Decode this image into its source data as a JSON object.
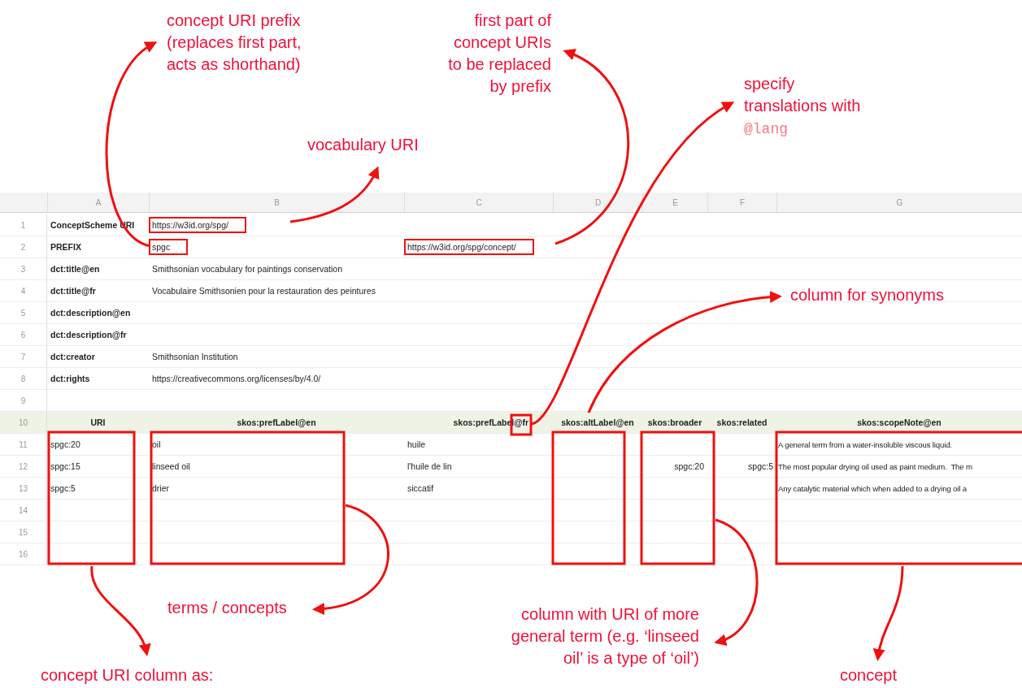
{
  "annotations": [
    {
      "kind": "note",
      "lines": [
        "concept URI prefix",
        "(replaces first part,",
        "acts as shorthand)"
      ]
    },
    {
      "kind": "note",
      "lines": [
        "first part of",
        "concept URIs",
        "to be replaced",
        "by prefix"
      ]
    },
    {
      "kind": "note",
      "lines": [
        "vocabulary URI"
      ]
    },
    {
      "kind": "note",
      "lines": [
        "specify",
        "translations with"
      ]
    },
    {
      "kind": "code",
      "lines": [
        "@lang"
      ]
    },
    {
      "kind": "note",
      "lines": [
        "column for synonyms"
      ]
    },
    {
      "kind": "note",
      "lines": [
        "terms / concepts"
      ]
    },
    {
      "kind": "note",
      "lines": [
        "column with URI of more",
        "general term (e.g. ‘linseed",
        "oil’ is a type of ‘oil’)"
      ]
    },
    {
      "kind": "note",
      "lines": [
        "concept URI column as:"
      ]
    },
    {
      "kind": "note",
      "lines": [
        "concept"
      ]
    }
  ],
  "sheet": {
    "columns": [
      "A",
      "B",
      "C",
      "D",
      "E",
      "F",
      "G"
    ],
    "rows": [
      {
        "number": "1",
        "kind": "meta",
        "cells": [
          "ConceptScheme URI",
          "https://w3id.org/spg/"
        ],
        "framed": [
          false,
          true
        ]
      },
      {
        "number": "2",
        "kind": "meta",
        "cells": [
          "PREFIX",
          "spgc",
          "https://w3id.org/spg/concept/"
        ],
        "framed": [
          false,
          true,
          true
        ]
      },
      {
        "number": "3",
        "kind": "meta",
        "cells": [
          "dct:title@en",
          "Smithsonian vocabulary for paintings conservation"
        ]
      },
      {
        "number": "4",
        "kind": "meta",
        "cells": [
          "dct:title@fr",
          "Vocabulaire Smithsonien pour la restauration des peintures"
        ]
      },
      {
        "number": "5",
        "kind": "meta",
        "cells": [
          "dct:description@en"
        ]
      },
      {
        "number": "6",
        "kind": "meta",
        "cells": [
          "dct:description@fr"
        ]
      },
      {
        "number": "7",
        "kind": "meta",
        "cells": [
          "dct:creator",
          "Smithsonian Institution"
        ]
      },
      {
        "number": "8",
        "kind": "meta",
        "cells": [
          "dct:rights",
          "https://creativecommons.org/licenses/by/4.0/"
        ]
      },
      {
        "number": "9",
        "kind": "meta",
        "cells": []
      },
      {
        "number": "10",
        "kind": "header",
        "cells": [
          "URI",
          "skos:prefLabel@en",
          "skos:prefLabel@fr",
          "skos:altLabel@en",
          "skos:broader",
          "skos:related",
          "skos:scopeNote@en"
        ]
      },
      {
        "number": "11",
        "kind": "data",
        "cells": [
          "spgc:20",
          "oil",
          "huile",
          "",
          "",
          "",
          "A general term from a water-insoluble viscous liquid."
        ]
      },
      {
        "number": "12",
        "kind": "data",
        "cells": [
          "spgc:15",
          "linseed oil",
          "l'huile de lin",
          "",
          "spgc:20",
          "spgc:5",
          "The most popular drying oil used as paint medium.  The m"
        ]
      },
      {
        "number": "13",
        "kind": "data",
        "cells": [
          "spgc:5",
          "drier",
          "siccatif",
          "",
          "",
          "",
          "Any catalytic material which when added to a drying oil a"
        ]
      },
      {
        "number": "14",
        "kind": "data",
        "cells": []
      },
      {
        "number": "15",
        "kind": "data",
        "cells": []
      },
      {
        "number": "16",
        "kind": "data",
        "cells": []
      }
    ]
  }
}
